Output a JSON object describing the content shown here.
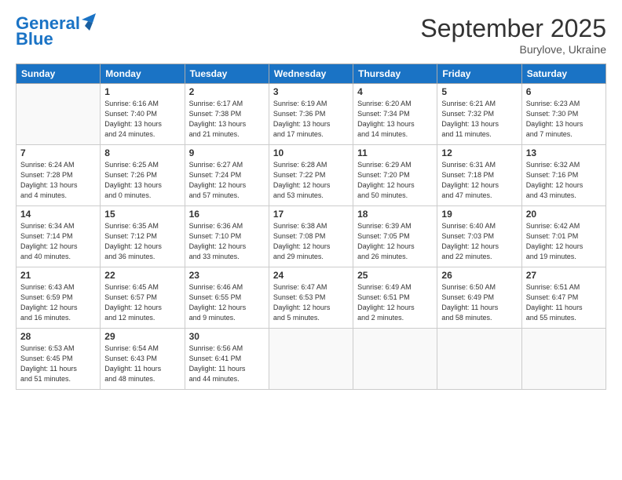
{
  "header": {
    "logo_line1": "General",
    "logo_line2": "Blue",
    "month": "September 2025",
    "location": "Burylove, Ukraine"
  },
  "weekdays": [
    "Sunday",
    "Monday",
    "Tuesday",
    "Wednesday",
    "Thursday",
    "Friday",
    "Saturday"
  ],
  "weeks": [
    [
      {
        "day": "",
        "info": ""
      },
      {
        "day": "1",
        "info": "Sunrise: 6:16 AM\nSunset: 7:40 PM\nDaylight: 13 hours\nand 24 minutes."
      },
      {
        "day": "2",
        "info": "Sunrise: 6:17 AM\nSunset: 7:38 PM\nDaylight: 13 hours\nand 21 minutes."
      },
      {
        "day": "3",
        "info": "Sunrise: 6:19 AM\nSunset: 7:36 PM\nDaylight: 13 hours\nand 17 minutes."
      },
      {
        "day": "4",
        "info": "Sunrise: 6:20 AM\nSunset: 7:34 PM\nDaylight: 13 hours\nand 14 minutes."
      },
      {
        "day": "5",
        "info": "Sunrise: 6:21 AM\nSunset: 7:32 PM\nDaylight: 13 hours\nand 11 minutes."
      },
      {
        "day": "6",
        "info": "Sunrise: 6:23 AM\nSunset: 7:30 PM\nDaylight: 13 hours\nand 7 minutes."
      }
    ],
    [
      {
        "day": "7",
        "info": "Sunrise: 6:24 AM\nSunset: 7:28 PM\nDaylight: 13 hours\nand 4 minutes."
      },
      {
        "day": "8",
        "info": "Sunrise: 6:25 AM\nSunset: 7:26 PM\nDaylight: 13 hours\nand 0 minutes."
      },
      {
        "day": "9",
        "info": "Sunrise: 6:27 AM\nSunset: 7:24 PM\nDaylight: 12 hours\nand 57 minutes."
      },
      {
        "day": "10",
        "info": "Sunrise: 6:28 AM\nSunset: 7:22 PM\nDaylight: 12 hours\nand 53 minutes."
      },
      {
        "day": "11",
        "info": "Sunrise: 6:29 AM\nSunset: 7:20 PM\nDaylight: 12 hours\nand 50 minutes."
      },
      {
        "day": "12",
        "info": "Sunrise: 6:31 AM\nSunset: 7:18 PM\nDaylight: 12 hours\nand 47 minutes."
      },
      {
        "day": "13",
        "info": "Sunrise: 6:32 AM\nSunset: 7:16 PM\nDaylight: 12 hours\nand 43 minutes."
      }
    ],
    [
      {
        "day": "14",
        "info": "Sunrise: 6:34 AM\nSunset: 7:14 PM\nDaylight: 12 hours\nand 40 minutes."
      },
      {
        "day": "15",
        "info": "Sunrise: 6:35 AM\nSunset: 7:12 PM\nDaylight: 12 hours\nand 36 minutes."
      },
      {
        "day": "16",
        "info": "Sunrise: 6:36 AM\nSunset: 7:10 PM\nDaylight: 12 hours\nand 33 minutes."
      },
      {
        "day": "17",
        "info": "Sunrise: 6:38 AM\nSunset: 7:08 PM\nDaylight: 12 hours\nand 29 minutes."
      },
      {
        "day": "18",
        "info": "Sunrise: 6:39 AM\nSunset: 7:05 PM\nDaylight: 12 hours\nand 26 minutes."
      },
      {
        "day": "19",
        "info": "Sunrise: 6:40 AM\nSunset: 7:03 PM\nDaylight: 12 hours\nand 22 minutes."
      },
      {
        "day": "20",
        "info": "Sunrise: 6:42 AM\nSunset: 7:01 PM\nDaylight: 12 hours\nand 19 minutes."
      }
    ],
    [
      {
        "day": "21",
        "info": "Sunrise: 6:43 AM\nSunset: 6:59 PM\nDaylight: 12 hours\nand 16 minutes."
      },
      {
        "day": "22",
        "info": "Sunrise: 6:45 AM\nSunset: 6:57 PM\nDaylight: 12 hours\nand 12 minutes."
      },
      {
        "day": "23",
        "info": "Sunrise: 6:46 AM\nSunset: 6:55 PM\nDaylight: 12 hours\nand 9 minutes."
      },
      {
        "day": "24",
        "info": "Sunrise: 6:47 AM\nSunset: 6:53 PM\nDaylight: 12 hours\nand 5 minutes."
      },
      {
        "day": "25",
        "info": "Sunrise: 6:49 AM\nSunset: 6:51 PM\nDaylight: 12 hours\nand 2 minutes."
      },
      {
        "day": "26",
        "info": "Sunrise: 6:50 AM\nSunset: 6:49 PM\nDaylight: 11 hours\nand 58 minutes."
      },
      {
        "day": "27",
        "info": "Sunrise: 6:51 AM\nSunset: 6:47 PM\nDaylight: 11 hours\nand 55 minutes."
      }
    ],
    [
      {
        "day": "28",
        "info": "Sunrise: 6:53 AM\nSunset: 6:45 PM\nDaylight: 11 hours\nand 51 minutes."
      },
      {
        "day": "29",
        "info": "Sunrise: 6:54 AM\nSunset: 6:43 PM\nDaylight: 11 hours\nand 48 minutes."
      },
      {
        "day": "30",
        "info": "Sunrise: 6:56 AM\nSunset: 6:41 PM\nDaylight: 11 hours\nand 44 minutes."
      },
      {
        "day": "",
        "info": ""
      },
      {
        "day": "",
        "info": ""
      },
      {
        "day": "",
        "info": ""
      },
      {
        "day": "",
        "info": ""
      }
    ]
  ]
}
